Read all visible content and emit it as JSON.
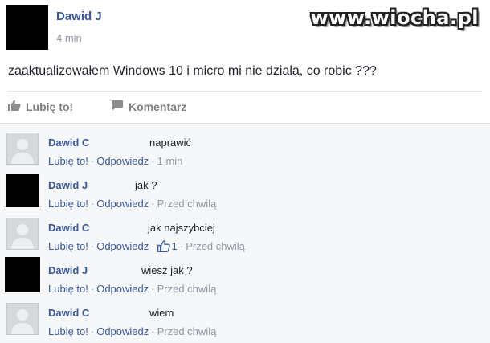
{
  "watermark": "www.wiocha.pl",
  "post": {
    "author": "Dawid J",
    "time": "4 min",
    "text": "zaaktualizowałem Windows 10 i micro mi nie dziala, co robic ???"
  },
  "actions": {
    "like_label": "Lubię to!",
    "comment_label": "Komentarz"
  },
  "comments": [
    {
      "name": "Dawid C",
      "text": "naprawić",
      "like": "Lubię to!",
      "reply": "Odpowiedz",
      "time": "1 min",
      "avatar": "default-avatar"
    },
    {
      "name": "Dawid J",
      "text": "jak ?",
      "like": "Lubię to!",
      "reply": "Odpowiedz",
      "time": "Przed chwilą",
      "avatar": "black-avatar"
    },
    {
      "name": "Dawid C",
      "text": "jak najszybciej",
      "like": "Lubię to!",
      "reply": "Odpowiedz",
      "likes_count": "1",
      "time": "Przed chwilą",
      "avatar": "default-avatar"
    },
    {
      "name": "Dawid J",
      "text": "wiesz jak ?",
      "like": "Lubię to!",
      "reply": "Odpowiedz",
      "time": "Przed chwilą",
      "avatar": "black-avatar"
    },
    {
      "name": "Dawid C",
      "text": "wiem",
      "like": "Lubię to!",
      "reply": "Odpowiedz",
      "time": "Przed chwilą",
      "avatar": "default-avatar"
    }
  ],
  "colors": {
    "link": "#3b5998",
    "meta": "#9197a3",
    "comments_bg": "#f6f7f9"
  }
}
